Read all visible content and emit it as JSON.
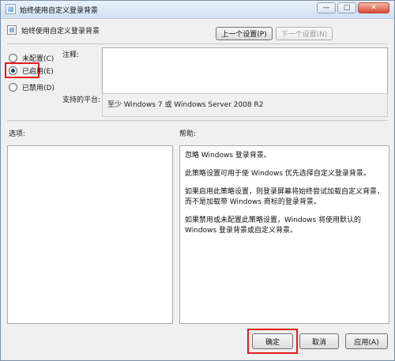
{
  "window": {
    "title": "始终使用自定义登录背景",
    "policy_name": "始终使用自定义登录背景",
    "controls": {
      "minimize": "—",
      "maximize": "□",
      "close": "✕"
    }
  },
  "nav": {
    "prev_label": "上一个设置(P)",
    "next_label": "下一个设置(N)"
  },
  "options": {
    "not_configured": "未配置(C)",
    "enabled": "已启用(E)",
    "disabled": "已禁用(D)",
    "selected": "enabled"
  },
  "fields": {
    "comment_label": "注释:",
    "comment_value": "",
    "platform_label": "支持的平台:",
    "platform_value": "至少 Windows 7 或 Windows Server 2008 R2"
  },
  "sections": {
    "options_label": "选项:",
    "help_label": "帮助:"
  },
  "help": {
    "paragraphs": [
      "忽略 Windows 登录背景。",
      "此策略设置可用于使 Windows 优先选择自定义登录背景。",
      "如果启用此策略设置，则登录屏幕将始终尝试加载自定义背景，而不是加载带 Windows 商标的登录背景。",
      "如果禁用或未配置此策略设置，Windows 将使用默认的 Windows 登录背景或自定义背景。"
    ]
  },
  "footer": {
    "ok_label": "确定",
    "cancel_label": "取消",
    "apply_label": "应用(A)"
  },
  "colors": {
    "highlight": "#e31d1d"
  }
}
